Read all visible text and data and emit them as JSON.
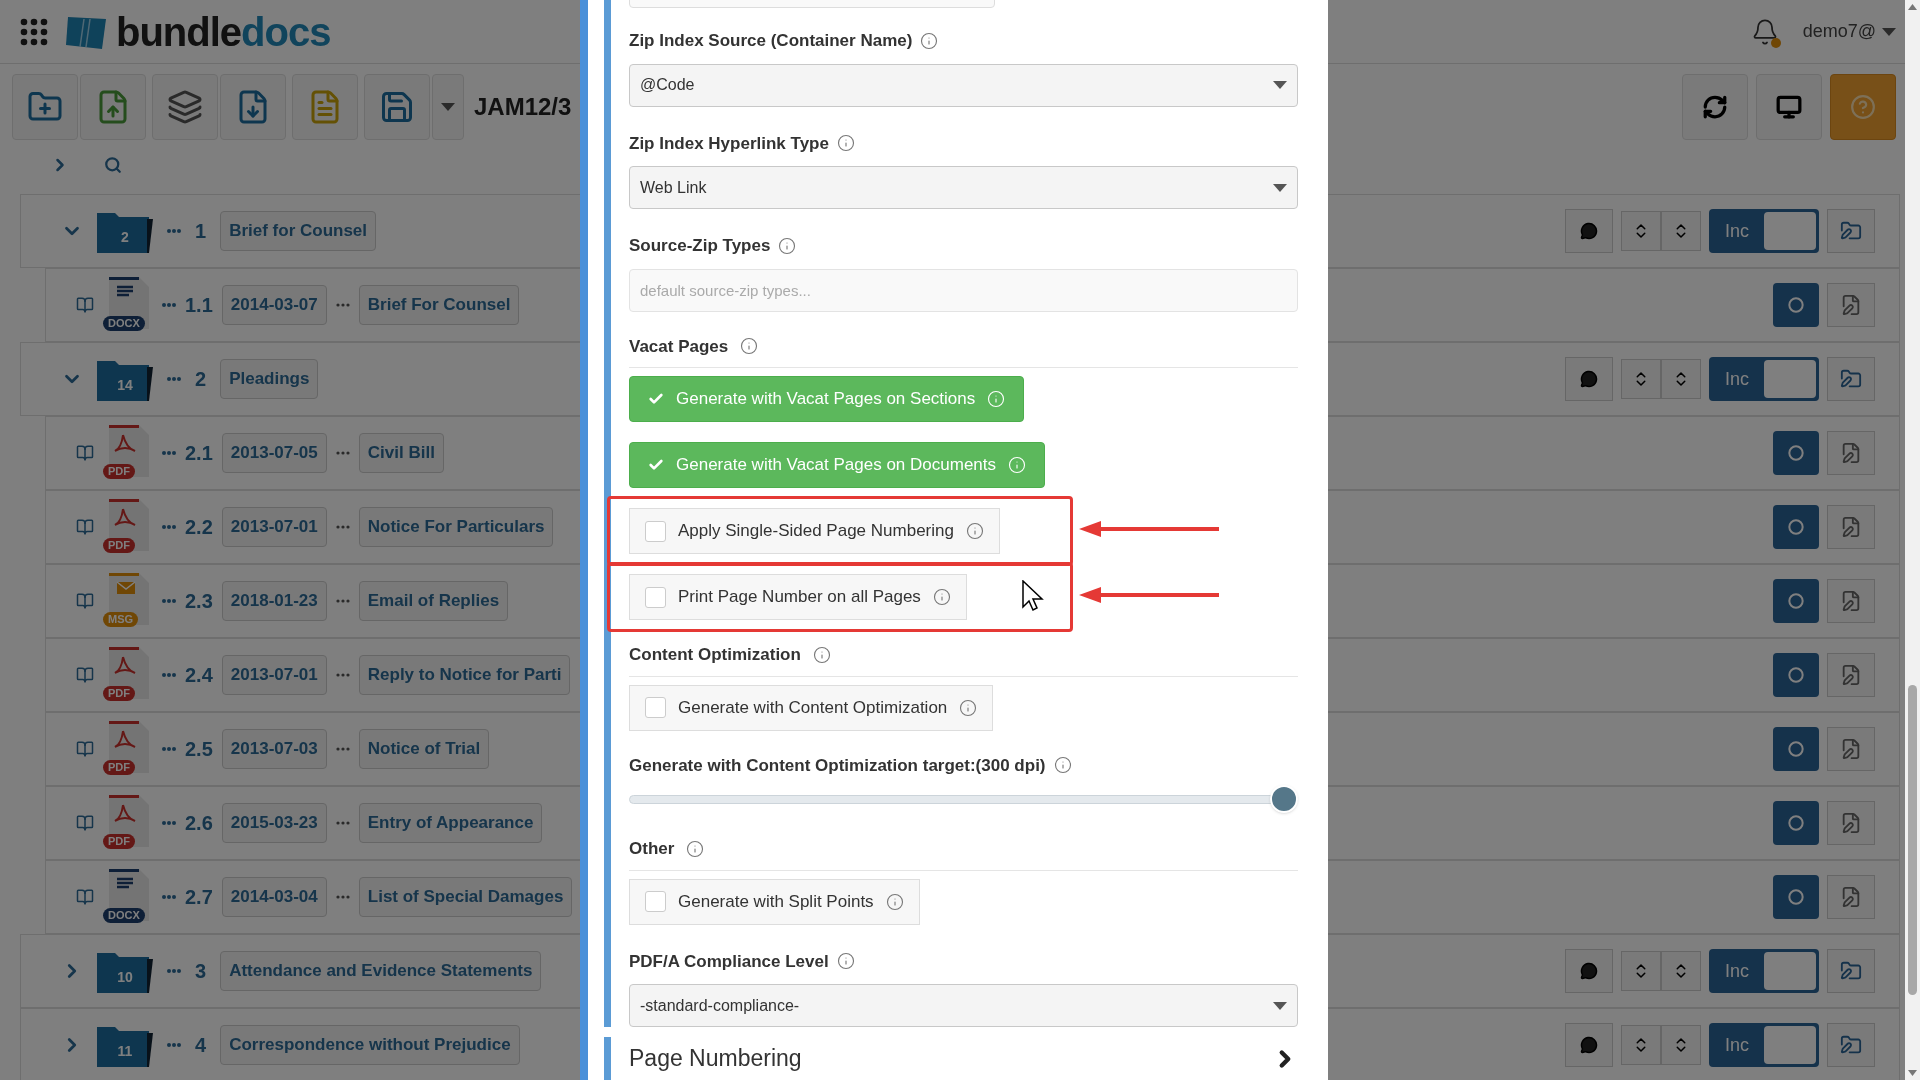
{
  "header": {
    "logo": {
      "part1": "bundle",
      "part2": "docs"
    },
    "user": "demo7@"
  },
  "toolbar": {
    "case_ref": "JAM12/3"
  },
  "tree": [
    {
      "kind": "section",
      "number": "1",
      "title": "Brief for Counsel",
      "count": "2",
      "expanded": true,
      "toggle_label": "Inc",
      "children": [
        {
          "kind": "word",
          "number": "1.1",
          "date": "2014-03-07",
          "title": "Brief For Counsel",
          "badge": "DOCX"
        }
      ]
    },
    {
      "kind": "section",
      "number": "2",
      "title": "Pleadings",
      "count": "14",
      "expanded": true,
      "toggle_label": "Inc",
      "children": [
        {
          "kind": "pdf",
          "number": "2.1",
          "date": "2013-07-05",
          "title": "Civil Bill",
          "badge": "PDF"
        },
        {
          "kind": "pdf",
          "number": "2.2",
          "date": "2013-07-01",
          "title": "Notice For Particulars",
          "badge": "PDF"
        },
        {
          "kind": "msg",
          "number": "2.3",
          "date": "2018-01-23",
          "title": "Email of Replies",
          "badge": "MSG"
        },
        {
          "kind": "pdf",
          "number": "2.4",
          "date": "2013-07-01",
          "title": "Reply to Notice for Parti",
          "badge": "PDF"
        },
        {
          "kind": "pdf",
          "number": "2.5",
          "date": "2013-07-03",
          "title": "Notice of Trial",
          "badge": "PDF"
        },
        {
          "kind": "pdf",
          "number": "2.6",
          "date": "2015-03-23",
          "title": "Entry of Appearance",
          "badge": "PDF"
        },
        {
          "kind": "word",
          "number": "2.7",
          "date": "2014-03-04",
          "title": "List of Special Damages",
          "badge": "DOCX"
        }
      ]
    },
    {
      "kind": "section",
      "number": "3",
      "title": "Attendance and Evidence Statements",
      "count": "10",
      "expanded": false,
      "toggle_label": "Inc"
    },
    {
      "kind": "section",
      "number": "4",
      "title": "Correspondence without Prejudice",
      "count": "11",
      "expanded": false,
      "toggle_label": "Inc"
    }
  ],
  "modal": {
    "items": [
      {
        "kind": "select",
        "label": "Zip Index Source (Container Name)",
        "value": "@Code"
      },
      {
        "kind": "select",
        "label": "Zip Index Hyperlink Type",
        "value": "Web Link"
      },
      {
        "kind": "input",
        "label": "Source-Zip Types",
        "placeholder": "default source-zip types..."
      },
      {
        "kind": "heading",
        "label": "Vacat Pages"
      },
      {
        "kind": "checkbox",
        "label": "Generate with Vacat Pages on Sections",
        "checked": true,
        "annotated": false
      },
      {
        "kind": "checkbox",
        "label": "Generate with Vacat Pages on Documents",
        "checked": true,
        "annotated": false
      },
      {
        "kind": "checkbox",
        "label": "Apply Single-Sided Page Numbering",
        "checked": false,
        "annotated": true
      },
      {
        "kind": "checkbox",
        "label": "Print Page Number on all Pages",
        "checked": false,
        "annotated": true
      },
      {
        "kind": "heading",
        "label": "Content Optimization"
      },
      {
        "kind": "checkbox",
        "label": "Generate with Content Optimization",
        "checked": false,
        "annotated": false
      },
      {
        "kind": "slider",
        "label": "Generate with Content Optimization target:(300 dpi)",
        "level": 1
      },
      {
        "kind": "heading",
        "label": "Other"
      },
      {
        "kind": "checkbox",
        "label": "Generate with Split Points",
        "checked": false,
        "annotated": false
      },
      {
        "kind": "select",
        "label": "PDF/A Compliance Level",
        "value": "-standard-compliance-"
      }
    ],
    "next_section": "Page Numbering"
  }
}
